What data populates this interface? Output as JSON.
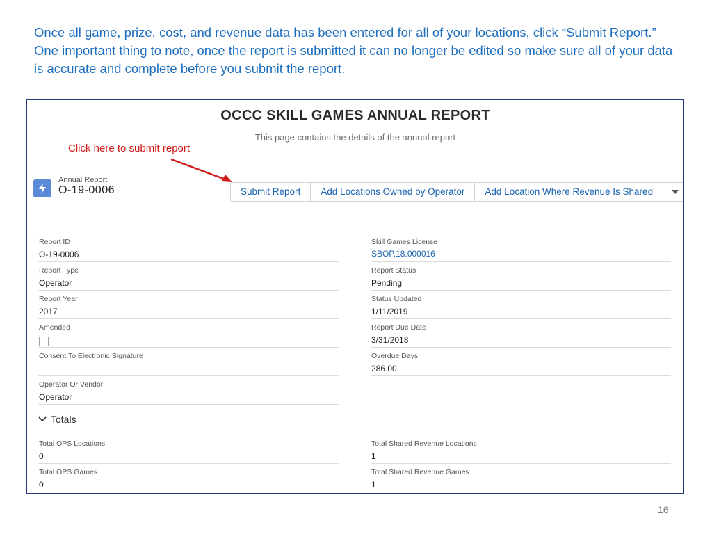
{
  "intro_text": "Once all game, prize, cost, and revenue data has been entered for all of your locations, click “Submit Report.”  One important thing to note, once the report is submitted it can no longer be edited so make sure all of your data is accurate and complete before you submit the report.",
  "header": {
    "title": "OCCC SKILL GAMES ANNUAL REPORT",
    "subtitle": "This page contains the details of the annual report"
  },
  "annotation": {
    "text": "Click here to submit report",
    "color": "#d11a1a"
  },
  "record": {
    "type_label": "Annual Report",
    "name": "O-19-0006",
    "icon": "lightning-bolt-icon"
  },
  "actions": {
    "submit_report": "Submit Report",
    "add_locations_owned": "Add Locations Owned by Operator",
    "add_location_shared": "Add Location Where Revenue Is Shared",
    "more_icon": "chevron-down-icon"
  },
  "fields": {
    "report_id": {
      "label": "Report ID",
      "value": "O-19-0006"
    },
    "skill_games_license": {
      "label": "Skill Games License",
      "value": "SBOP.18.000016"
    },
    "report_type": {
      "label": "Report Type",
      "value": "Operator"
    },
    "report_status": {
      "label": "Report Status",
      "value": "Pending"
    },
    "report_year": {
      "label": "Report Year",
      "value": "2017"
    },
    "status_updated": {
      "label": "Status Updated",
      "value": "1/11/2019"
    },
    "amended": {
      "label": "Amended",
      "checked": false
    },
    "report_due_date": {
      "label": "Report Due Date",
      "value": "3/31/2018"
    },
    "consent": {
      "label": "Consent To Electronic Signature",
      "value": ""
    },
    "overdue_days": {
      "label": "Overdue Days",
      "value": "286.00"
    },
    "operator_or_vendor": {
      "label": "Operator Or Vendor",
      "value": "Operator"
    }
  },
  "totals": {
    "section_label": "Totals",
    "total_ops_locations": {
      "label": "Total OPS Locations",
      "value": "0"
    },
    "total_shared_revenue_locations": {
      "label": "Total Shared Revenue Locations",
      "value": "1"
    },
    "total_ops_games": {
      "label": "Total OPS Games",
      "value": "0"
    },
    "total_shared_revenue_games": {
      "label": "Total Shared Revenue Games",
      "value": "1"
    }
  },
  "page_number": "16",
  "colors": {
    "intro_text": "#1f6fbf",
    "link": "#1a64b0",
    "record_icon_bg": "#5b8bd8",
    "frame_border": "#1e3a7a"
  }
}
